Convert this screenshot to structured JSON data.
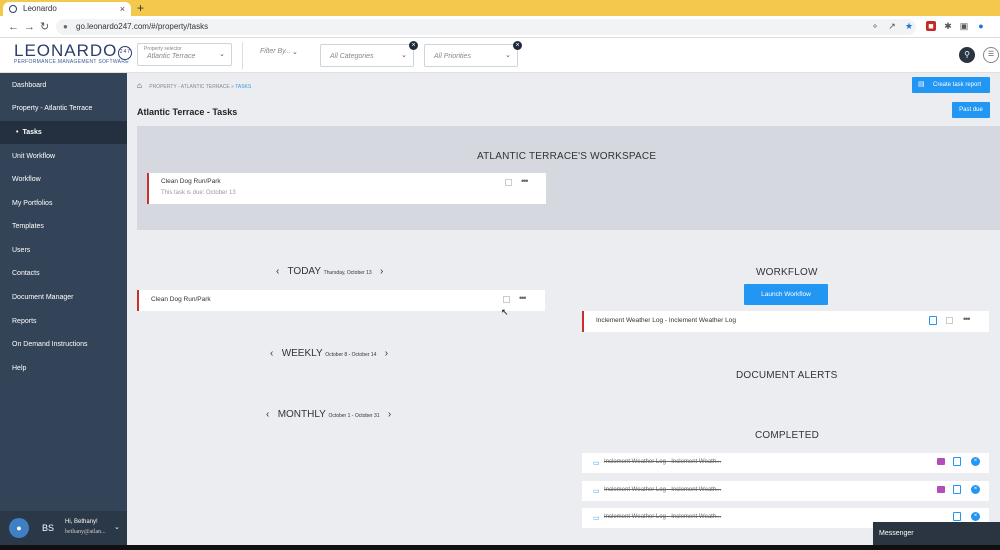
{
  "browser": {
    "tab_title": "Leonardo",
    "tab_close": "×",
    "new_tab": "+",
    "url": "go.leonardo247.com/#/property/tasks"
  },
  "header": {
    "logo_text": "LEONARDO",
    "logo_badge": "247",
    "logo_subtitle": "PERFORMANCE MANAGEMENT SOFTWARE",
    "property_selector_label": "Property selector",
    "property_selector_value": "Atlantic Terrace",
    "filter_by": "Filter By...",
    "categories_value": "All Categories",
    "priorities_value": "All Priorities"
  },
  "sidebar": {
    "items": [
      {
        "label": "Dashboard"
      },
      {
        "label": "Property - Atlantic Terrace"
      },
      {
        "label": "Tasks"
      },
      {
        "label": "Unit Workflow"
      },
      {
        "label": "Workflow"
      },
      {
        "label": "My Portfolios"
      },
      {
        "label": "Templates"
      },
      {
        "label": "Users"
      },
      {
        "label": "Contacts"
      },
      {
        "label": "Document Manager"
      },
      {
        "label": "Reports"
      },
      {
        "label": "On Demand Instructions"
      },
      {
        "label": "Help"
      }
    ],
    "profile": {
      "initials": "BS",
      "greeting": "Hi, Bethany!",
      "email": "bethany@atlan..."
    }
  },
  "main": {
    "breadcrumb": {
      "parent": "PROPERTY - ATLANTIC TERRACE",
      "separator": "»",
      "current": "TASKS"
    },
    "page_title": "Atlantic Terrace - Tasks",
    "create_report_label": "Create task report",
    "past_due_label": "Past due",
    "workspace": {
      "title": "ATLANTIC TERRACE'S WORKSPACE",
      "task_name": "Clean Dog Run/Park",
      "task_due": "This task is due: October 13"
    },
    "today": {
      "label": "TODAY",
      "date": "Thursday, October 13",
      "task_name": "Clean Dog Run/Park"
    },
    "weekly": {
      "label": "WEEKLY",
      "range": "October 8 - October 14"
    },
    "monthly": {
      "label": "MONTHLY",
      "range": "October 1 - October 31"
    },
    "workflow": {
      "title": "WORKFLOW",
      "launch_label": "Launch Workflow",
      "task_name": "Inclement Weather Log - Inclement Weather Log"
    },
    "document_alerts_title": "DOCUMENT ALERTS",
    "completed": {
      "title": "COMPLETED",
      "items": [
        {
          "text": "Inclement Weather Log - Inclement Weath..."
        },
        {
          "text": "Inclement Weather Log - Inclement Weath..."
        },
        {
          "text": "Inclement Weather Log - Inclement Weath..."
        }
      ]
    }
  },
  "messenger_label": "Messenger",
  "colors": {
    "accent": "#2196f3",
    "sidebar": "#344458",
    "task_border": "#c9302c"
  }
}
